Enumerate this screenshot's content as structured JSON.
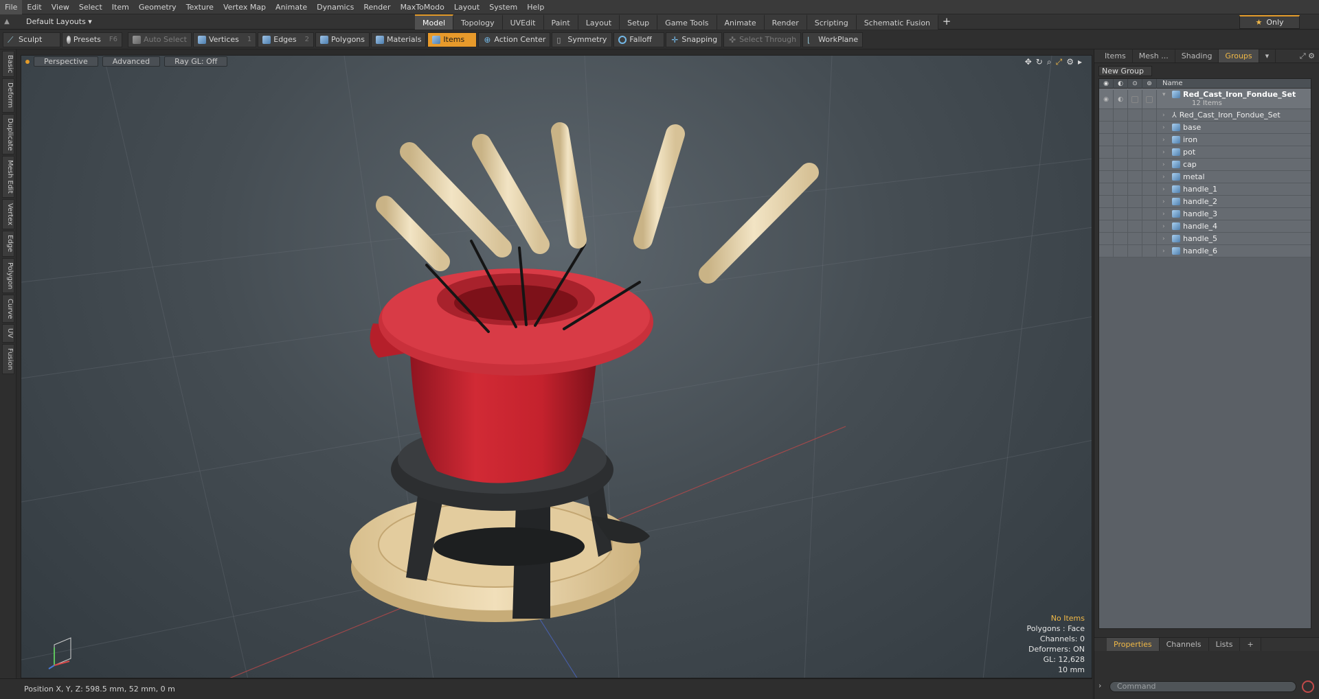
{
  "menu": [
    "File",
    "Edit",
    "View",
    "Select",
    "Item",
    "Geometry",
    "Texture",
    "Vertex Map",
    "Animate",
    "Dynamics",
    "Render",
    "MaxToModo",
    "Layout",
    "System",
    "Help"
  ],
  "layout_bar": {
    "layouts_label": "Default Layouts ▾",
    "tabs": [
      "Model",
      "Topology",
      "UVEdit",
      "Paint",
      "Layout",
      "Setup",
      "Game Tools",
      "Animate",
      "Render",
      "Scripting",
      "Schematic Fusion"
    ],
    "active_tab": "Model",
    "plus": "+",
    "only_label": "Only"
  },
  "toolbar": {
    "sculpt": "Sculpt",
    "presets": "Presets",
    "presets_key": "F6",
    "auto_select": "Auto Select",
    "vertices": "Vertices",
    "vertices_key": "1",
    "edges": "Edges",
    "edges_key": "2",
    "polygons": "Polygons",
    "materials": "Materials",
    "items": "Items",
    "action_center": "Action Center",
    "symmetry": "Symmetry",
    "falloff": "Falloff",
    "snapping": "Snapping",
    "select_through": "Select Through",
    "workplane": "WorkPlane"
  },
  "left_tabs": [
    "Basic",
    "Deform",
    "Duplicate",
    "Mesh Edit",
    "Vertex",
    "Edge",
    "Polygon",
    "Curve",
    "UV",
    "Fusion"
  ],
  "viewport": {
    "view_label": "Perspective",
    "shading_label": "Advanced",
    "raygl_label": "Ray GL: Off",
    "info": {
      "items": "No Items",
      "polygons": "Polygons : Face",
      "channels": "Channels: 0",
      "deformers": "Deformers: ON",
      "gl": "GL: 12,628",
      "scale": "10 mm"
    }
  },
  "status": {
    "position": "Position X, Y, Z:   598.5 mm, 52 mm, 0 m"
  },
  "right_panel": {
    "tabs": [
      "Items",
      "Mesh ...",
      "Shading",
      "Groups"
    ],
    "active_tab": "Groups",
    "new_group": "New Group",
    "col_name": "Name",
    "root": {
      "name": "Red_Cast_Iron_Fondue_Set",
      "count": "12 Items"
    },
    "children": [
      "Red_Cast_Iron_Fondue_Set",
      "base",
      "iron",
      "pot",
      "cap",
      "metal",
      "handle_1",
      "handle_2",
      "handle_3",
      "handle_4",
      "handle_5",
      "handle_6"
    ],
    "bottom_tabs": [
      "Properties",
      "Channels",
      "Lists"
    ],
    "bottom_active": "Properties",
    "command_placeholder": "Command"
  },
  "colors": {
    "accent": "#e39b2a",
    "pot_red": "#c8242f",
    "wood": "#e9d5ac",
    "iron": "#2b2d2f"
  }
}
